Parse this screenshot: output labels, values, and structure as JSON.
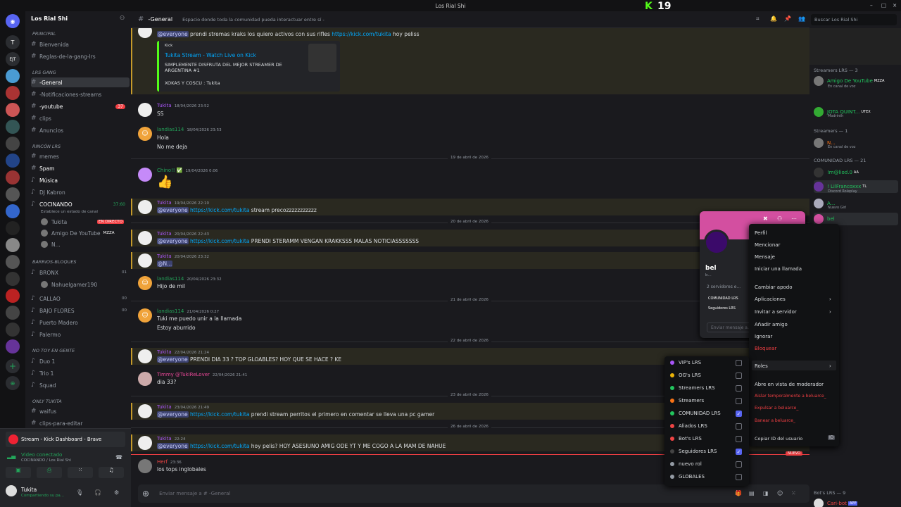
{
  "window": {
    "title": "Los Rial Shi",
    "kick_count": "19",
    "kick_logo": "K"
  },
  "servers": [
    {
      "label": "T"
    },
    {
      "label": "EJT"
    },
    {
      "label": "◉"
    },
    {
      "label": "◉"
    },
    {
      "label": "◉"
    },
    {
      "label": "◉"
    },
    {
      "label": "◉"
    },
    {
      "label": "◉"
    },
    {
      "label": "◉"
    },
    {
      "label": "◉"
    },
    {
      "label": "◉"
    },
    {
      "label": "◉"
    },
    {
      "label": "◉"
    },
    {
      "label": "◉"
    },
    {
      "label": "◉"
    },
    {
      "label": "◉"
    },
    {
      "label": "◉"
    },
    {
      "label": "◉"
    }
  ],
  "sidebar": {
    "server_name": "Los Rial Shi",
    "cat1": "Principal",
    "cat2": "LRS GANG",
    "cat3": "RINCÓN LRS",
    "cat4": "BARRIOS-BLOQUES",
    "cat5": "NO TOY EN GENTE",
    "cat6": "ONLY TUKITA",
    "channels": [
      {
        "name": "Bienvenida"
      },
      {
        "name": "Reglas-de-la-gang-lrs"
      },
      {
        "name": "-General"
      },
      {
        "name": "-Notificaciones-streams"
      },
      {
        "name": "-youtube",
        "badge": "37"
      },
      {
        "name": "clips"
      },
      {
        "name": "Anuncios"
      },
      {
        "name": "memes"
      },
      {
        "name": "Spam"
      },
      {
        "name": "Música"
      },
      {
        "name": "DJ Kabron"
      }
    ],
    "voice_cocinando": "COCINANDO",
    "voice_time": "37:60",
    "voice_status": "Establece un estado de canal",
    "voice_user1": "Tukita",
    "live_badge": "EN DIRECTO",
    "voice_user2": "Amigo De YouTube",
    "voice_user2_tag": "MZZA",
    "voice_user3": "N...",
    "barrios": [
      {
        "name": "BRONX",
        "count": "01",
        "max": "40"
      },
      {
        "name": "Nahuelgamer190"
      },
      {
        "name": "CALLAO",
        "count": "00",
        "max": "40"
      },
      {
        "name": "BAJO FLORES",
        "count": "00",
        "max": "40"
      },
      {
        "name": "Puerto Madero"
      },
      {
        "name": "Palermo"
      }
    ],
    "notoy": [
      {
        "name": "Duo 1"
      },
      {
        "name": "Trio 1"
      },
      {
        "name": "Squad"
      }
    ],
    "only": [
      {
        "name": "waifus"
      },
      {
        "name": "clips-para-editar"
      }
    ]
  },
  "stream_bar": {
    "title": "Stream - Kick Dashboard - Brave",
    "conn": "Video conectado",
    "sub": "COCINANDO / Los Rial Shi"
  },
  "user": {
    "name": "Tukita",
    "status": "Compartiendo su pa..."
  },
  "header": {
    "channel": "-General",
    "topic": "Espacio donde toda la comunidad pueda interactuar entre sí -",
    "search": "Buscar Los Rial Shi"
  },
  "messages": {
    "m0_everyone": "@everyone",
    "m0_text": " prendi stremas kraks los quiero activos con sus rifles ",
    "m0_link": "https://kick.com/tukita",
    "m0_after": " hoy peliss",
    "embed_provider": "Kick",
    "embed_title": "Tukita Stream - Watch Live on Kick",
    "embed_desc": "SIMPLEMENTE DISFRUTA DEL MEJOR STREAMER DE ARGENTINA #1",
    "embed_foot": "XOKAS Y COSCU : Tukita",
    "m1_name": "Tukita",
    "m1_time": "18/04/2026 23:52",
    "m1_text": "SS",
    "m2_name": "landias114",
    "m2_time": "18/04/2026 23:53",
    "m2_text": "Hola",
    "m2_text2": "No me deja",
    "d1": "19 de abril de 2026",
    "m3_name": "Chino!! ✅",
    "m3_time": "19/04/2026 0:06",
    "m3_text": "👍",
    "m4_name": "Tukita",
    "m4_time": "19/04/2026 22:10",
    "m4_everyone": "@everyone",
    "m4_link": "https://kick.com/tukita",
    "m4_text": " stream precozzzzzzzzzzz",
    "d2": "20 de abril de 2026",
    "m5_name": "Tukita",
    "m5_time": "20/04/2026 22:43",
    "m5_everyone": "@everyone",
    "m5_link": "https://kick.com/tukita",
    "m5_text": " PRENDI STERAMM VENGAN KRAKKSSS MALAS NOTICIASSSSSSS",
    "m6_name": "Tukita",
    "m6_time": "20/04/2026 23:32",
    "m6_text": "@N...",
    "m7_name": "landias114",
    "m7_time": "20/04/2026 23:32",
    "m7_text": "Hijo de mil",
    "d3": "21 de abril de 2026",
    "m8_name": "landias114",
    "m8_time": "21/04/2026 0:27",
    "m8_text": "Tuki me puedo unir a la llamada",
    "m8_text2": "Estoy aburrido",
    "d4": "22 de abril de 2026",
    "m9_name": "Tukita",
    "m9_time": "22/04/2026 21:24",
    "m9_everyone": "@everyone",
    "m9_text": " PRENDI DIA 33 ? TOP GLOABLES?  HOY QUE SE HACE ? KE",
    "m10_name": "Timmy @TukiReLover",
    "m10_time": "22/04/2026 21:41",
    "m10_text": "dia 33?",
    "d5": "23 de abril de 2026",
    "m11_name": "Tukita",
    "m11_time": "23/04/2026 21:49",
    "m11_everyone": "@everyone",
    "m11_link": "https://kick.com/tukita",
    "m11_text": " prendi stream perritos el primero en comentar se lleva una pc gamer",
    "d6": "26 de abril de 2026",
    "m12_name": "Tukita",
    "m12_time": "22:24",
    "m12_everyone": "@everyone",
    "m12_link": "https://kick.com/tukita",
    "m12_text": " hoy pelis? HOY ASESIUNO AMIG ODE YT Y ME COGO A LA MAM DE NAHUE",
    "new_label": "NUEVO",
    "m13_name": "Herf",
    "m13_time": "23:36",
    "m13_text": "los tops inglobales"
  },
  "input": {
    "placeholder": "Enviar mensaje a # -General"
  },
  "members": {
    "cat_streamers": "Streamers LRS — 3",
    "s1": "Amigo De YouTube",
    "s1_tag": "MZZA",
    "s1_sub": "En canal de voz",
    "s2": "JOTA QUINT...",
    "s2_tag": "UTEX",
    "s2_sub": "Modrinth",
    "cat_stream2": "Streamers — 1",
    "s3": "N...",
    "s3_sub": "En canal de voz",
    "cat_com": "COMUNIDAD LRS — 21",
    "c1": "!m@liod.0",
    "c1_tag": "AA",
    "c2": "! LilFrancoxxx",
    "c2_tag": "TL",
    "c2_sub": "Discord Roleplay",
    "c3": "A...",
    "c3_sub": "Nuevo Girl",
    "c4": "bel",
    "cat_bots": "Bot's LRS — 9",
    "bot1": "Cari-bot",
    "bot1_tag": "APP"
  },
  "profile": {
    "name": "bel",
    "sub": "b...",
    "servers": "2 servidores e...",
    "role1": "COMUNIDAD LRS",
    "role2": "Seguidores LRS",
    "msg": "Enviar mensaje a..."
  },
  "context_menu": {
    "items": [
      "Perfil",
      "Mencionar",
      "Mensaje",
      "Iniciar una llamada",
      "Cambiar apodo",
      "Aplicaciones",
      "Invitar a servidor",
      "Añadir amigo",
      "Ignorar",
      "Bloquear",
      "Roles",
      "Abre en vista de moderador",
      "Aislar temporalmente a beluarce_",
      "Expulsar a beluarce_",
      "Banear a beluarce_",
      "Copiar ID del usuario"
    ]
  },
  "roles": [
    {
      "name": "VIP's LRS",
      "color": "#a855f7",
      "checked": false
    },
    {
      "name": "OG's LRS",
      "color": "#eab308",
      "checked": false
    },
    {
      "name": "Streamers LRS",
      "color": "#22c55e",
      "checked": false
    },
    {
      "name": "Streamers",
      "color": "#f97316",
      "checked": false
    },
    {
      "name": "COMUNIDAD LRS",
      "color": "#22c55e",
      "checked": true
    },
    {
      "name": "Aliados LRS",
      "color": "#ef4444",
      "checked": false
    },
    {
      "name": "Bot's LRS",
      "color": "#ef4444",
      "checked": false
    },
    {
      "name": "Seguidores LRS",
      "color": "#444",
      "checked": true
    },
    {
      "name": "nuevo rol",
      "color": "#949ba4",
      "checked": false
    },
    {
      "name": "GLOBALES",
      "color": "#949ba4",
      "checked": false
    }
  ]
}
